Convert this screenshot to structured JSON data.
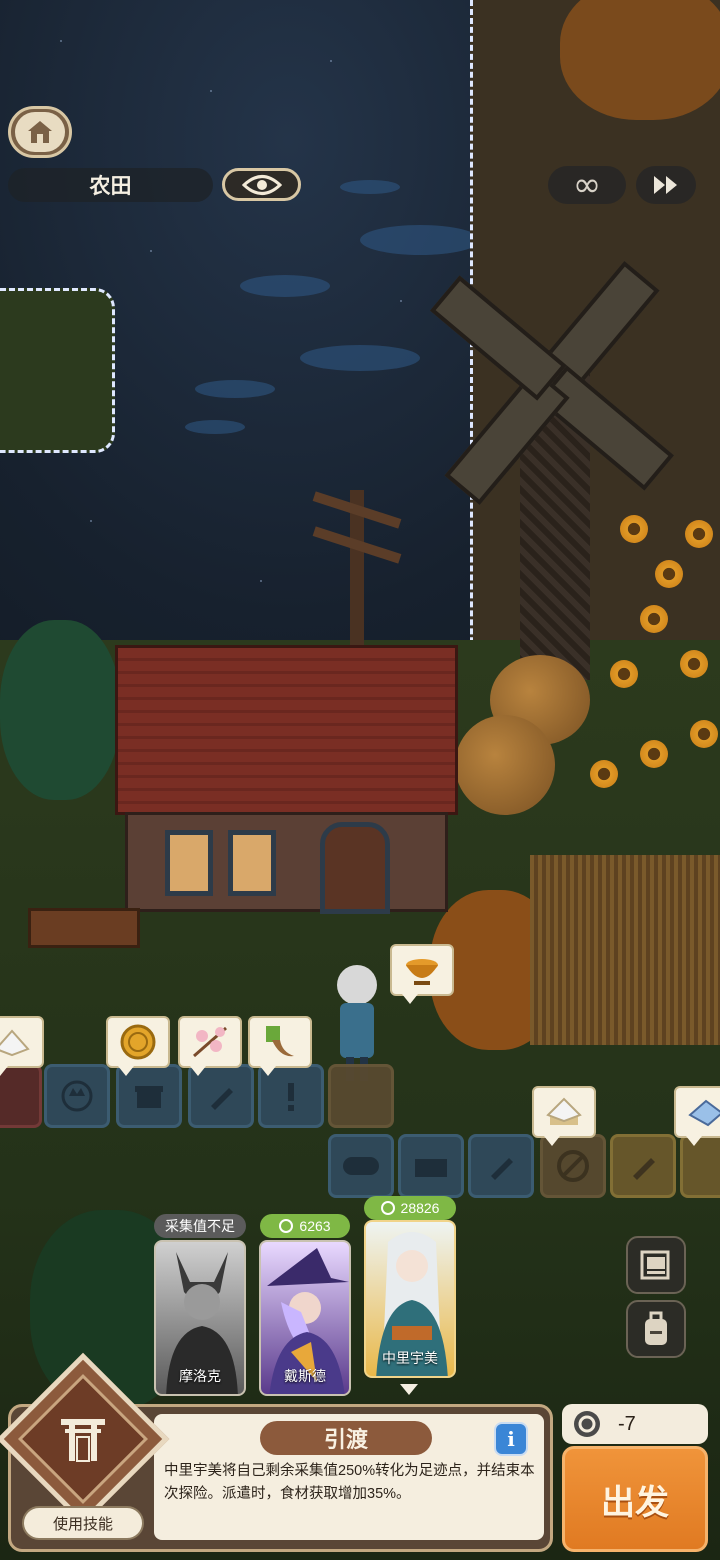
{
  "hud": {
    "location": "农田",
    "home_icon": "home-icon",
    "eye_icon": "eye-icon",
    "infinity_icon": "∞",
    "fast_forward_icon": "fast-forward-icon"
  },
  "characters": [
    {
      "name": "摩洛克",
      "badge": "采集值不足",
      "badge_color": "#5b5b5b",
      "palette": "gray"
    },
    {
      "name": "戴斯德",
      "badge": "6263",
      "badge_color": "#7fb845",
      "palette": "purple"
    },
    {
      "name": "中里宇美",
      "badge": "28826",
      "badge_color": "#7fb845",
      "palette": "teal"
    }
  ],
  "items": {
    "bubble_main": "golden-bowl-icon",
    "bubble_coin": "gold-coin-icon",
    "bubble_flower": "cherry-blossom-icon",
    "bubble_root": "ginseng-root-icon",
    "bubble_salt": "salt-crystal-icon",
    "bubble_crystal": "blue-crystal-icon"
  },
  "skill": {
    "name": "引渡",
    "description": "中里宇美将自己剩余采集值250%转化为足迹点，并结束本次探险。派遣时，食材获取增加35%。",
    "use_label": "使用技能",
    "info_icon": "i"
  },
  "cost": "-7",
  "depart_label": "出发",
  "colors": {
    "accent_orange": "#e8862d",
    "panel_brown": "#5a4636",
    "badge_green": "#7fb845"
  }
}
